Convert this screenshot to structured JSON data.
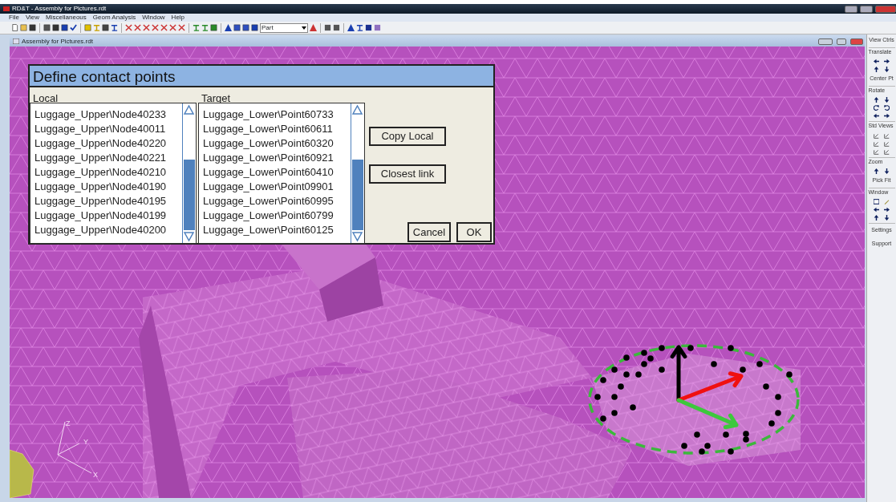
{
  "window": {
    "title": "RD&T - Assembly for Pictures.rdt"
  },
  "menu": [
    "File",
    "View",
    "Miscellaneous",
    "Geom Analysis",
    "Window",
    "Help"
  ],
  "toolbar": {
    "part_select": {
      "value": "Part"
    }
  },
  "document": {
    "title": "Assembly for Pictures.rdt"
  },
  "viewport": {
    "axes": [
      "Z",
      "Y",
      "X"
    ]
  },
  "dialog": {
    "title": "Define contact points",
    "local": {
      "label": "Local",
      "items": [
        "Luggage_Upper\\Node40233",
        "Luggage_Upper\\Node40011",
        "Luggage_Upper\\Node40220",
        "Luggage_Upper\\Node40221",
        "Luggage_Upper\\Node40210",
        "Luggage_Upper\\Node40190",
        "Luggage_Upper\\Node40195",
        "Luggage_Upper\\Node40199",
        "Luggage_Upper\\Node40200"
      ]
    },
    "target": {
      "label": "Target",
      "items": [
        "Luggage_Lower\\Point60733",
        "Luggage_Lower\\Point60611",
        "Luggage_Lower\\Point60320",
        "Luggage_Lower\\Point60921",
        "Luggage_Lower\\Point60410",
        "Luggage_Lower\\Point09901",
        "Luggage_Lower\\Point60995",
        "Luggage_Lower\\Point60799",
        "Luggage_Lower\\Point60125"
      ]
    },
    "side_buttons": [
      "Copy Local",
      "Closest link"
    ],
    "buttons": [
      "Cancel",
      "OK"
    ]
  },
  "view_controls": {
    "title": "View Ctrls",
    "groups": [
      {
        "label": "Translate",
        "kind": "translate",
        "buttons": [
          "Center Pt"
        ]
      },
      {
        "label": "Rotate",
        "kind": "rotate"
      },
      {
        "label": "Std Views",
        "kind": "std-views"
      },
      {
        "label": "Zoom",
        "kind": "zoom",
        "buttons": [
          "Pick",
          "Fit"
        ]
      },
      {
        "label": "Window",
        "kind": "window"
      }
    ],
    "buttons": [
      "Settings",
      "Support"
    ]
  }
}
